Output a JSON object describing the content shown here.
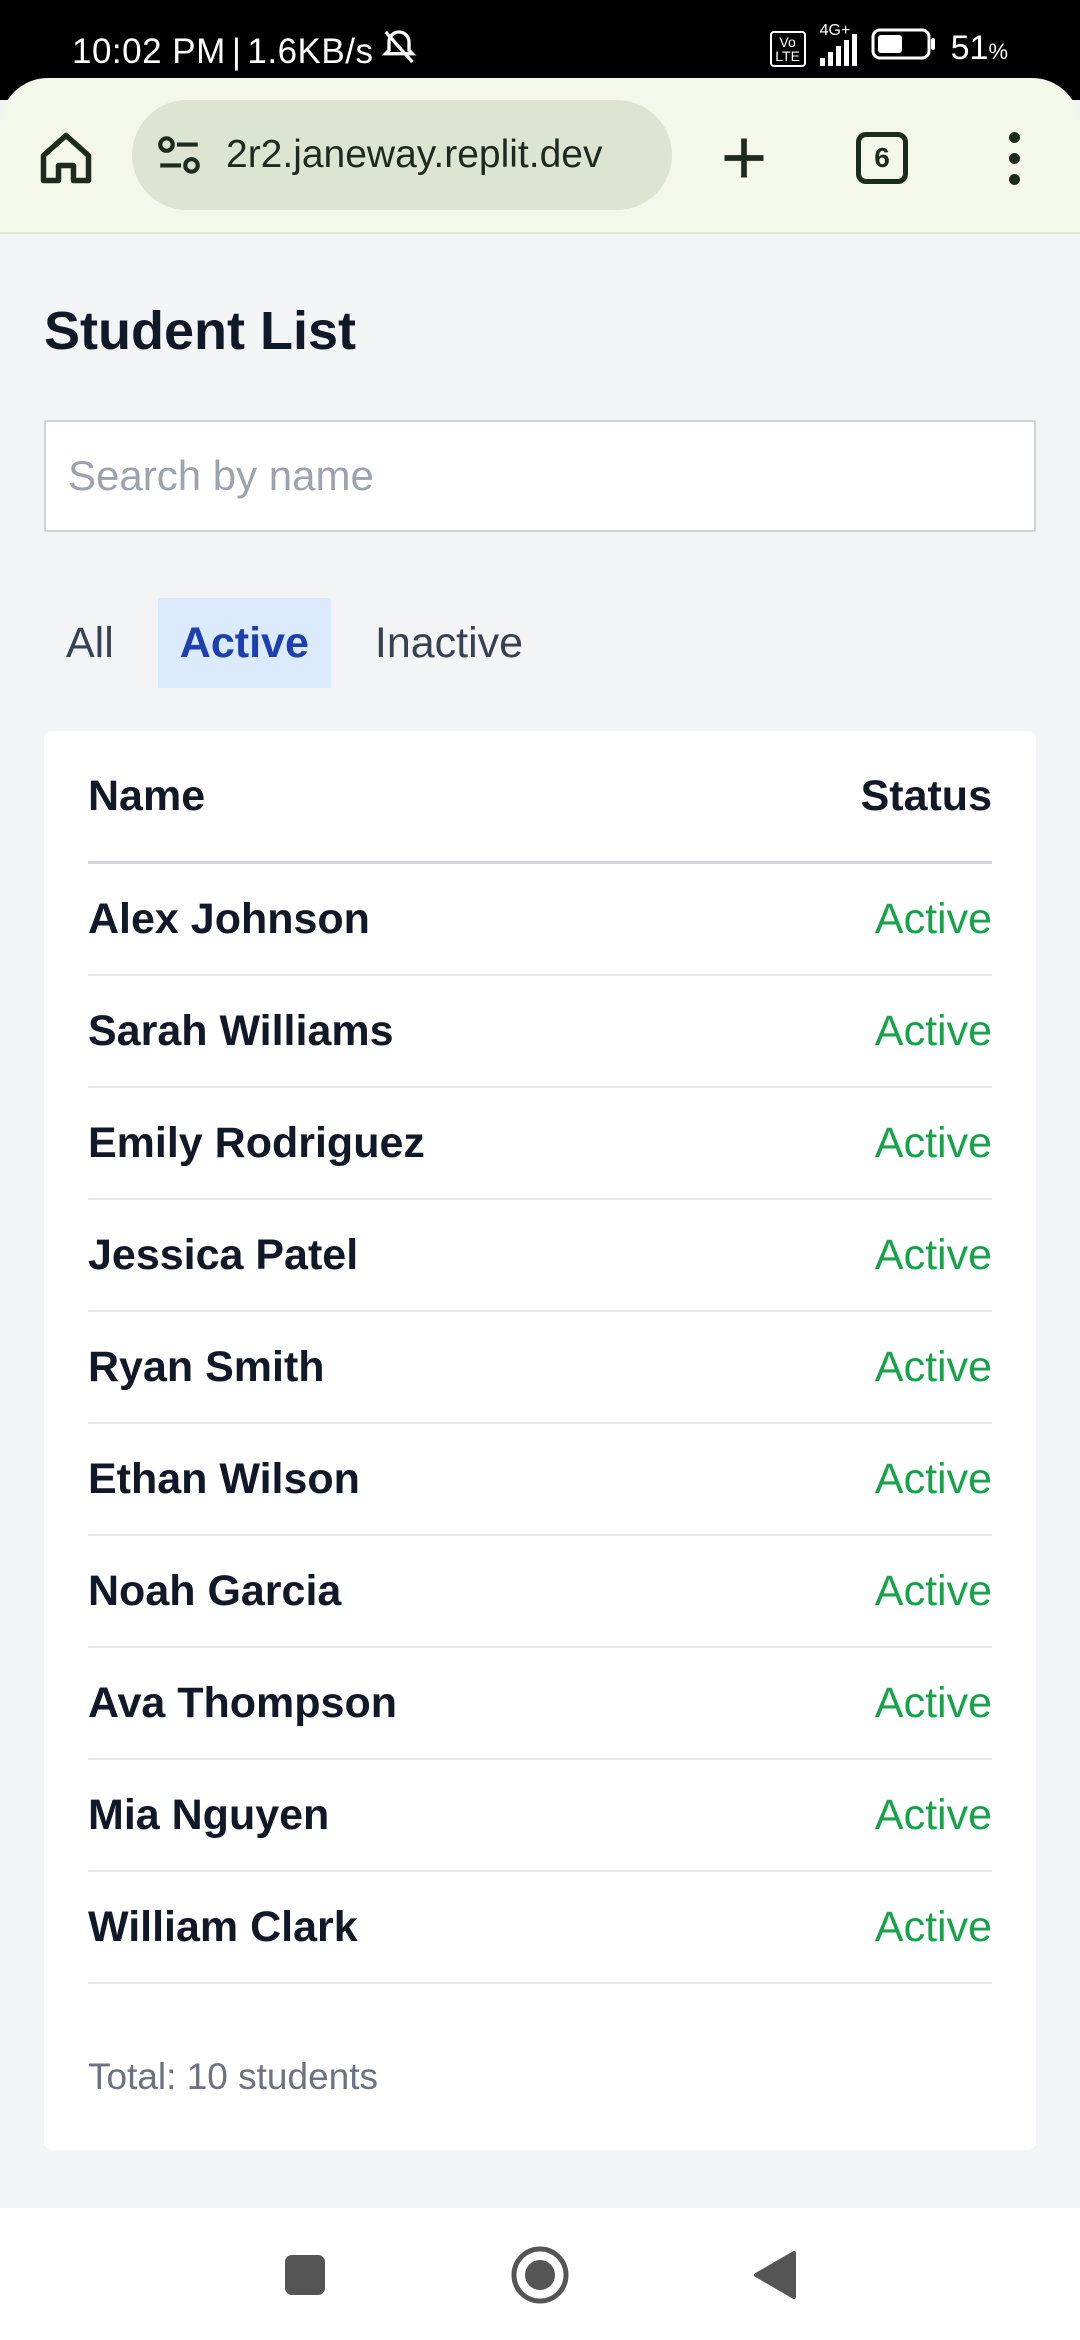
{
  "status_bar": {
    "time": "10:02 PM",
    "speed": "1.6KB/s",
    "network": "4G+",
    "volte": "Vo LTE",
    "battery_percent": "51",
    "battery_unit": "%"
  },
  "browser": {
    "url": "2r2.janeway.replit.dev",
    "tab_count": "6"
  },
  "page": {
    "title": "Student List",
    "search_placeholder": "Search by name",
    "search_value": "",
    "filters": [
      {
        "label": "All",
        "selected": false
      },
      {
        "label": "Active",
        "selected": true
      },
      {
        "label": "Inactive",
        "selected": false
      }
    ],
    "table": {
      "headers": {
        "name": "Name",
        "status": "Status"
      },
      "rows": [
        {
          "name": "Alex Johnson",
          "status": "Active"
        },
        {
          "name": "Sarah Williams",
          "status": "Active"
        },
        {
          "name": "Emily Rodriguez",
          "status": "Active"
        },
        {
          "name": "Jessica Patel",
          "status": "Active"
        },
        {
          "name": "Ryan Smith",
          "status": "Active"
        },
        {
          "name": "Ethan Wilson",
          "status": "Active"
        },
        {
          "name": "Noah Garcia",
          "status": "Active"
        },
        {
          "name": "Ava Thompson",
          "status": "Active"
        },
        {
          "name": "Mia Nguyen",
          "status": "Active"
        },
        {
          "name": "William Clark",
          "status": "Active"
        }
      ]
    },
    "total_text": "Total: 10 students"
  },
  "colors": {
    "active_status": "#16a34a",
    "selected_tab_bg": "#dbeafe",
    "selected_tab_text": "#1e40af",
    "browser_bar": "#f4f8ea"
  },
  "icons": {
    "home": "home-icon",
    "site_settings": "tune-icon",
    "new_tab": "plus-icon",
    "tabs": "tab-switcher-icon",
    "menu": "more-vert-icon",
    "nav_recents": "square-icon",
    "nav_home": "circle-icon",
    "nav_back": "back-triangle-icon"
  }
}
